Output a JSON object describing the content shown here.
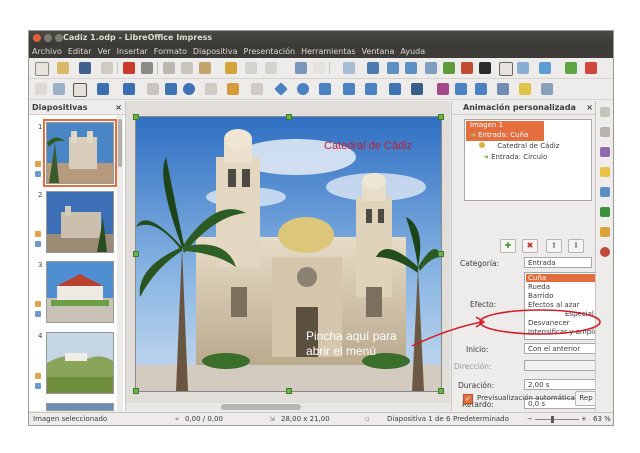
{
  "window": {
    "title": "Cadiz 1.odp - LibreOffice Impress"
  },
  "menubar": {
    "items": [
      "Archivo",
      "Editar",
      "Ver",
      "Insertar",
      "Formato",
      "Diapositiva",
      "Presentación",
      "Herramientas",
      "Ventana",
      "Ayuda"
    ]
  },
  "slides_panel": {
    "title": "Diapositivas",
    "close": "×",
    "slides": [
      "1",
      "2",
      "3",
      "4"
    ]
  },
  "slide": {
    "title_text": "Catedral de Cádiz",
    "annotation": "Pincha aquí para\nabrir el menú"
  },
  "animation_panel": {
    "title": "Animación personalizada",
    "close": "×",
    "tree": [
      "Imagen 1",
      "Entrada: Cuña",
      "Catedral de Cádiz",
      "Entrada: Círculo"
    ],
    "category_label": "Categoría:",
    "category_value": "Entrada",
    "effect_label": "Efecto:",
    "effects": [
      "Cuña",
      "Rueda",
      "Barrido",
      "Efectos al azar"
    ],
    "effects_group_label": "Especial",
    "effects_special": [
      "Desvanecer",
      "Intensificar y ampliar"
    ],
    "start_label": "Inicio:",
    "start_value": "Con el anterior",
    "direction_label": "Dirección:",
    "duration_label": "Duración:",
    "duration_value": "2,00 s",
    "delay_label": "Retardo:",
    "delay_value": "0,0 s",
    "autopreview_label": "Previsualización automática",
    "autopreview_checked": true,
    "play_button": "Rep"
  },
  "statusbar": {
    "selection": "Imagen seleccionado",
    "position": "0,00 / 0,00",
    "size": "28,00 x 21,00",
    "slide_info": "Diapositiva 1 de 6",
    "layout": "Predeterminado",
    "zoom": "63 %",
    "zoom_minus": "−",
    "zoom_plus": "+"
  },
  "colors": {
    "accent_orange": "#e46e3e",
    "annotation_red": "#d21e28",
    "title_text": "#c0202e"
  }
}
